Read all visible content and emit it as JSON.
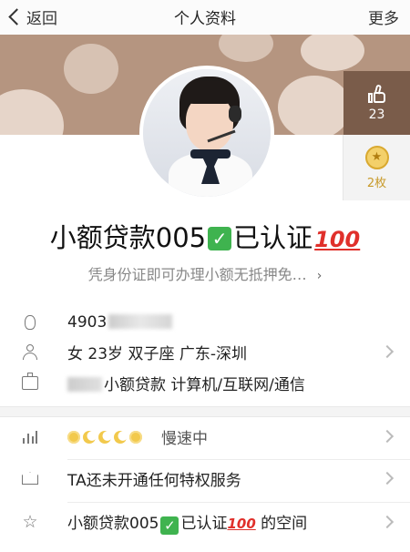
{
  "nav": {
    "back_label": "返回",
    "title": "个人资料",
    "more_label": "更多"
  },
  "side": {
    "like_count": "23",
    "badge_count": "2枚"
  },
  "profile": {
    "name_prefix": "小额贷款005",
    "name_suffix": "已认证",
    "check_emoji": "✓",
    "hundred_emoji": "100",
    "signature": "凭身份证即可办理小额无抵押免…",
    "signature_more": "›"
  },
  "info": {
    "qq_number_visible": "4903",
    "gender_age_zodiac_location": "女 23岁 双子座 广东-深圳",
    "company_suffix": "小额贷款 计算机/互联网/通信"
  },
  "rows": {
    "level_status": "慢速中",
    "privilege": "TA还未开通任何特权服务",
    "space_prefix": "小额贷款005",
    "space_mid": "已认证",
    "space_suffix": "的空间"
  },
  "icons": {
    "back": "chevron-left-icon",
    "like": "thumbs-up-icon",
    "badge": "medal-icon",
    "qq": "qq-penguin-icon",
    "user": "user-icon",
    "company": "briefcase-icon",
    "level": "bar-chart-icon",
    "privilege": "crown-icon",
    "space": "star-icon"
  },
  "colors": {
    "cover": "#b59580",
    "like_bg": "#7a5c4a",
    "check_green": "#3fb34f",
    "hundred_red": "#e0302b"
  }
}
